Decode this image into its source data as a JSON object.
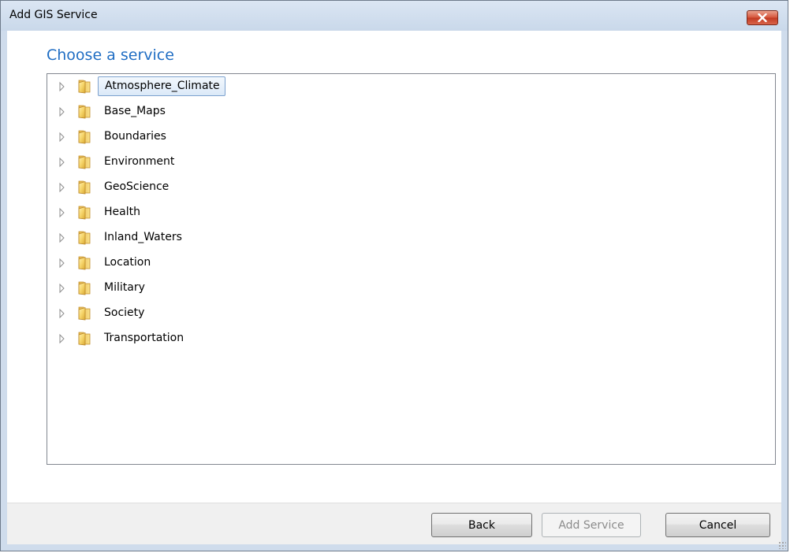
{
  "window": {
    "title": "Add GIS Service"
  },
  "heading": "Choose a service",
  "tree": {
    "items": [
      {
        "label": "Atmosphere_Climate",
        "selected": true
      },
      {
        "label": "Base_Maps"
      },
      {
        "label": "Boundaries"
      },
      {
        "label": "Environment"
      },
      {
        "label": "GeoScience"
      },
      {
        "label": "Health"
      },
      {
        "label": "Inland_Waters"
      },
      {
        "label": "Location"
      },
      {
        "label": "Military"
      },
      {
        "label": "Society"
      },
      {
        "label": "Transportation"
      }
    ]
  },
  "buttons": {
    "back": "Back",
    "add_service": "Add Service",
    "cancel": "Cancel"
  },
  "icons": {
    "close": "close-icon",
    "folder": "folder-icon",
    "expander": "expand-arrow-icon"
  },
  "colors": {
    "heading": "#1f6dc3",
    "close_button": "#c13a22",
    "selection_border": "#7da2ce"
  }
}
